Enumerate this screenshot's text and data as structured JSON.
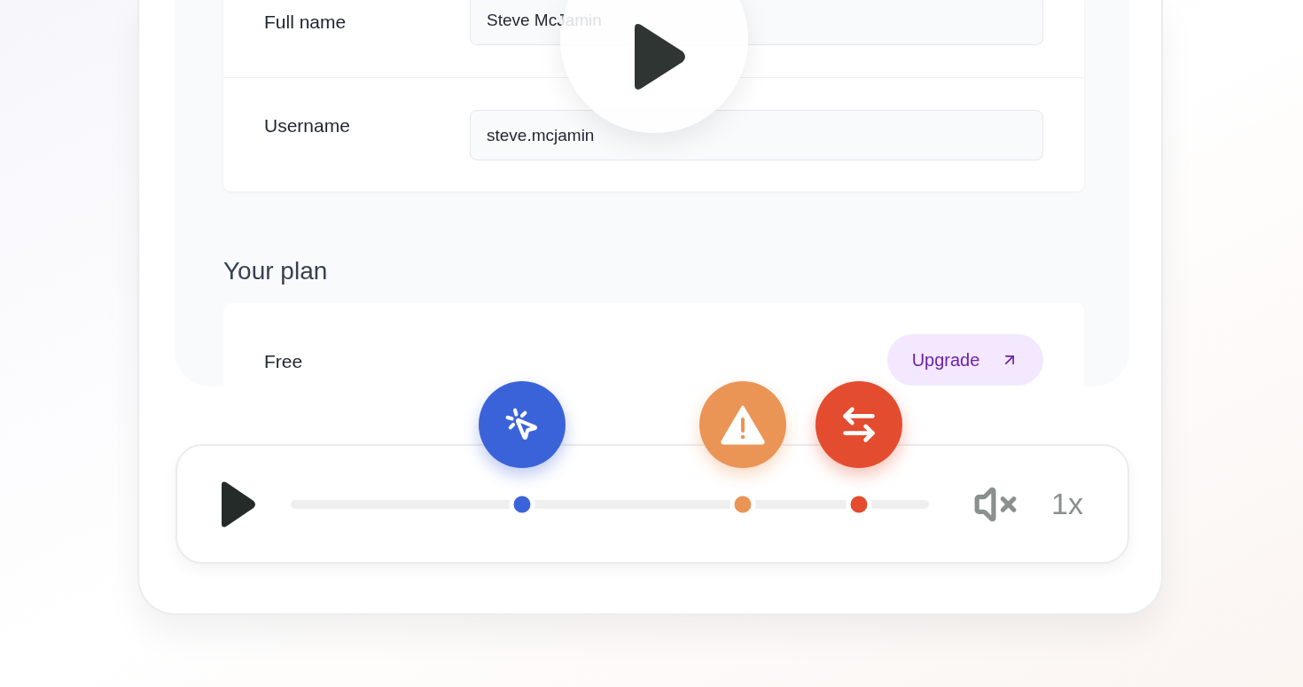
{
  "account": {
    "rows": [
      {
        "label": "Full name",
        "value": "Steve McJamin"
      },
      {
        "label": "Username",
        "value": "steve.mcjamin"
      }
    ]
  },
  "plan": {
    "heading": "Your plan",
    "name": "Free",
    "action": "Upgrade"
  },
  "player": {
    "muted": true,
    "speed": "1x",
    "markers": [
      {
        "kind": "click",
        "color": "#3b63d9",
        "level": 0.3625
      },
      {
        "kind": "warning",
        "color": "#ea9455",
        "level": 0.708
      },
      {
        "kind": "swap",
        "color": "#e34c2e",
        "level": 0.89
      }
    ]
  }
}
